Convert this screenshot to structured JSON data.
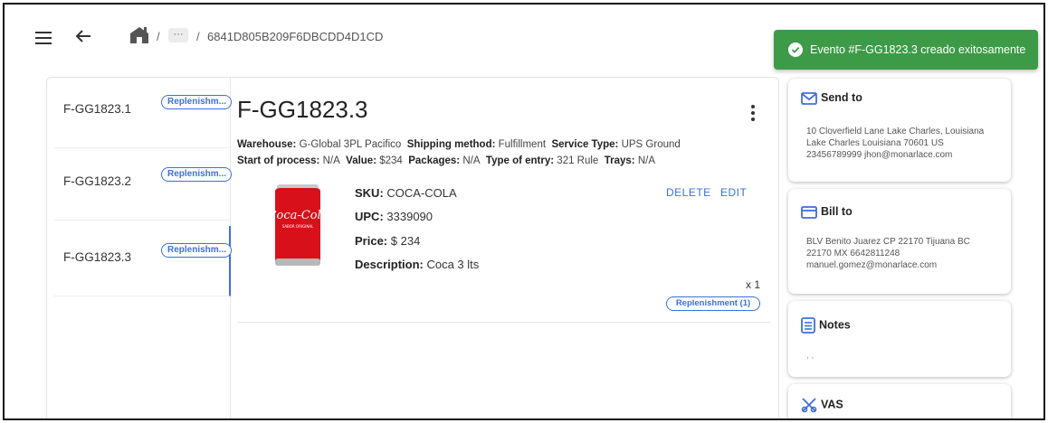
{
  "breadcrumb": {
    "separator": "/",
    "more": "···",
    "current": "6841D805B209F6DBCDD4D1CD"
  },
  "toast": {
    "message": "Evento #F-GG1823.3 creado exitosamente",
    "color": "#3d9a47"
  },
  "orders": [
    {
      "name": "F-GG1823.1",
      "chip": "Replenishm..."
    },
    {
      "name": "F-GG1823.2",
      "chip": "Replenishm..."
    },
    {
      "name": "F-GG1823.3",
      "chip": "Replenishm..."
    }
  ],
  "detail": {
    "title": "F-GG1823.3",
    "meta1": {
      "warehouse_label": "Warehouse:",
      "warehouse": "G-Global 3PL Pacifico",
      "shipping_label": "Shipping method:",
      "shipping": "Fulfillment",
      "service_label": "Service Type:",
      "service": "UPS Ground"
    },
    "meta2": {
      "start_label": "Start of process:",
      "start": "N/A",
      "value_label": "Value:",
      "value": "$234",
      "packages_label": "Packages:",
      "packages": "N/A",
      "entry_label": "Type of entry:",
      "entry": "321 Rule",
      "trays_label": "Trays:",
      "trays": "N/A"
    },
    "product": {
      "sku_label": "SKU:",
      "sku": "COCA-COLA",
      "upc_label": "UPC:",
      "upc": "3339090",
      "price_label": "Price:",
      "price": "$ 234",
      "description_label": "Description:",
      "description": "Coca 3 lts",
      "quantity": "x 1",
      "chip": "Replenishment (1)",
      "delete_label": "DELETE",
      "edit_label": "EDIT",
      "image_text": "Coca-Cola",
      "image_subtext": "SABOR ORIGINAL"
    }
  },
  "cards": {
    "send_to": {
      "title": "Send to",
      "line1": "10 Cloverfield Lane Lake Charles, Louisiana",
      "line2": "Lake Charles Louisiana 70601 US",
      "line3": "23456789999 jhon@monarlace.com"
    },
    "bill_to": {
      "title": "Bill to",
      "line1": "BLV Benito Juarez CP 22170 Tijuana BC",
      "line2": "22170 MX 6642811248",
      "line3": "manuel.gomez@monarlace.com"
    },
    "notes": {
      "title": "Notes",
      "body": ", ,"
    },
    "vas": {
      "title": "VAS"
    }
  },
  "colors": {
    "accent": "#3e6fd8",
    "success": "#3d9a47",
    "coke_red": "#d7101a"
  }
}
